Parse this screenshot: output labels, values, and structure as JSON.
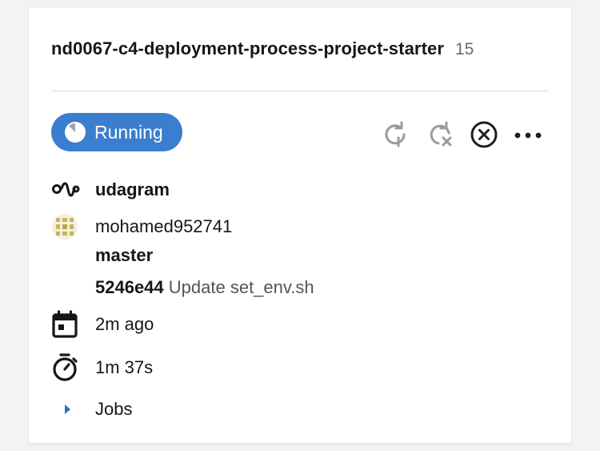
{
  "pipeline": {
    "name": "nd0067-c4-deployment-process-project-starter",
    "number": "15"
  },
  "status": {
    "label": "Running",
    "color": "#3b7ecf"
  },
  "actions": {
    "rerun_icon": "rerun-icon",
    "rerun_failed_icon": "rerun-failed-icon",
    "cancel_icon": "cancel-icon",
    "more_icon": "more-icon"
  },
  "details": {
    "workflow": "udagram",
    "user": "mohamed952741",
    "branch": "master",
    "commit_sha": "5246e44",
    "commit_message": "Update set_env.sh",
    "started": "2m ago",
    "duration": "1m 37s",
    "jobs_label": "Jobs"
  },
  "colors": {
    "accent": "#2f72c2",
    "text": "#161616",
    "muted": "#6b6b6b"
  }
}
